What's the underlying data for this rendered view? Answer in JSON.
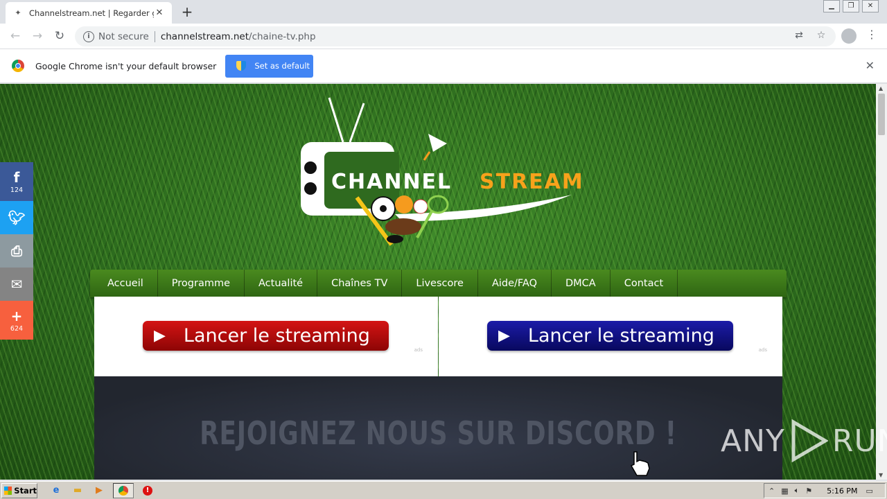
{
  "browser": {
    "tab_title": "Channelstream.net | Regarder gratuit",
    "new_tab_label": "+",
    "url_security": "Not secure",
    "url_host": "channelstream.net",
    "url_path": "/chaine-tv.php",
    "infobar_message": "Google Chrome isn't your default browser",
    "infobar_button": "Set as default"
  },
  "site": {
    "logo_part1": "CHANNEL",
    "logo_part2": "STREAM",
    "nav": [
      "Accueil",
      "Programme",
      "Actualité",
      "Chaînes TV",
      "Livescore",
      "Aide/FAQ",
      "DMCA",
      "Contact"
    ],
    "stream_button_left": "Lancer le streaming",
    "stream_button_right": "Lancer le streaming",
    "ads_label": "ads",
    "discord_banner": "REJOIGNEZ NOUS SUR DISCORD !",
    "social": {
      "facebook_count": "124",
      "more_count": "624"
    }
  },
  "watermark": {
    "left": "ANY",
    "right": "RUN"
  },
  "taskbar": {
    "start_label": "Start",
    "clock": "5:16 PM"
  },
  "colors": {
    "accent_blue": "#4285f4",
    "nav_green": "#3a7a18",
    "logo_orange": "#f7a21b",
    "stream_red": "#b30d0d",
    "stream_blue": "#12128a"
  }
}
